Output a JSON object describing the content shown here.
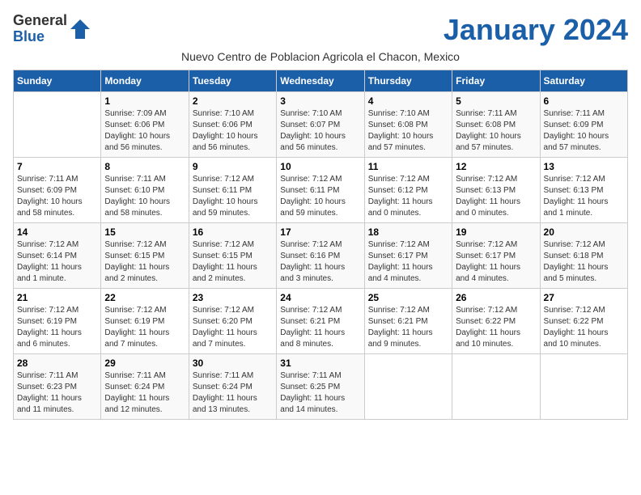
{
  "logo": {
    "general": "General",
    "blue": "Blue"
  },
  "header": {
    "month_title": "January 2024",
    "subtitle": "Nuevo Centro de Poblacion Agricola el Chacon, Mexico"
  },
  "days_of_week": [
    "Sunday",
    "Monday",
    "Tuesday",
    "Wednesday",
    "Thursday",
    "Friday",
    "Saturday"
  ],
  "weeks": [
    [
      {
        "day": "",
        "info": ""
      },
      {
        "day": "1",
        "info": "Sunrise: 7:09 AM\nSunset: 6:06 PM\nDaylight: 10 hours\nand 56 minutes."
      },
      {
        "day": "2",
        "info": "Sunrise: 7:10 AM\nSunset: 6:06 PM\nDaylight: 10 hours\nand 56 minutes."
      },
      {
        "day": "3",
        "info": "Sunrise: 7:10 AM\nSunset: 6:07 PM\nDaylight: 10 hours\nand 56 minutes."
      },
      {
        "day": "4",
        "info": "Sunrise: 7:10 AM\nSunset: 6:08 PM\nDaylight: 10 hours\nand 57 minutes."
      },
      {
        "day": "5",
        "info": "Sunrise: 7:11 AM\nSunset: 6:08 PM\nDaylight: 10 hours\nand 57 minutes."
      },
      {
        "day": "6",
        "info": "Sunrise: 7:11 AM\nSunset: 6:09 PM\nDaylight: 10 hours\nand 57 minutes."
      }
    ],
    [
      {
        "day": "7",
        "info": "Sunrise: 7:11 AM\nSunset: 6:09 PM\nDaylight: 10 hours\nand 58 minutes."
      },
      {
        "day": "8",
        "info": "Sunrise: 7:11 AM\nSunset: 6:10 PM\nDaylight: 10 hours\nand 58 minutes."
      },
      {
        "day": "9",
        "info": "Sunrise: 7:12 AM\nSunset: 6:11 PM\nDaylight: 10 hours\nand 59 minutes."
      },
      {
        "day": "10",
        "info": "Sunrise: 7:12 AM\nSunset: 6:11 PM\nDaylight: 10 hours\nand 59 minutes."
      },
      {
        "day": "11",
        "info": "Sunrise: 7:12 AM\nSunset: 6:12 PM\nDaylight: 11 hours\nand 0 minutes."
      },
      {
        "day": "12",
        "info": "Sunrise: 7:12 AM\nSunset: 6:13 PM\nDaylight: 11 hours\nand 0 minutes."
      },
      {
        "day": "13",
        "info": "Sunrise: 7:12 AM\nSunset: 6:13 PM\nDaylight: 11 hours\nand 1 minute."
      }
    ],
    [
      {
        "day": "14",
        "info": "Sunrise: 7:12 AM\nSunset: 6:14 PM\nDaylight: 11 hours\nand 1 minute."
      },
      {
        "day": "15",
        "info": "Sunrise: 7:12 AM\nSunset: 6:15 PM\nDaylight: 11 hours\nand 2 minutes."
      },
      {
        "day": "16",
        "info": "Sunrise: 7:12 AM\nSunset: 6:15 PM\nDaylight: 11 hours\nand 2 minutes."
      },
      {
        "day": "17",
        "info": "Sunrise: 7:12 AM\nSunset: 6:16 PM\nDaylight: 11 hours\nand 3 minutes."
      },
      {
        "day": "18",
        "info": "Sunrise: 7:12 AM\nSunset: 6:17 PM\nDaylight: 11 hours\nand 4 minutes."
      },
      {
        "day": "19",
        "info": "Sunrise: 7:12 AM\nSunset: 6:17 PM\nDaylight: 11 hours\nand 4 minutes."
      },
      {
        "day": "20",
        "info": "Sunrise: 7:12 AM\nSunset: 6:18 PM\nDaylight: 11 hours\nand 5 minutes."
      }
    ],
    [
      {
        "day": "21",
        "info": "Sunrise: 7:12 AM\nSunset: 6:19 PM\nDaylight: 11 hours\nand 6 minutes."
      },
      {
        "day": "22",
        "info": "Sunrise: 7:12 AM\nSunset: 6:19 PM\nDaylight: 11 hours\nand 7 minutes."
      },
      {
        "day": "23",
        "info": "Sunrise: 7:12 AM\nSunset: 6:20 PM\nDaylight: 11 hours\nand 7 minutes."
      },
      {
        "day": "24",
        "info": "Sunrise: 7:12 AM\nSunset: 6:21 PM\nDaylight: 11 hours\nand 8 minutes."
      },
      {
        "day": "25",
        "info": "Sunrise: 7:12 AM\nSunset: 6:21 PM\nDaylight: 11 hours\nand 9 minutes."
      },
      {
        "day": "26",
        "info": "Sunrise: 7:12 AM\nSunset: 6:22 PM\nDaylight: 11 hours\nand 10 minutes."
      },
      {
        "day": "27",
        "info": "Sunrise: 7:12 AM\nSunset: 6:22 PM\nDaylight: 11 hours\nand 10 minutes."
      }
    ],
    [
      {
        "day": "28",
        "info": "Sunrise: 7:11 AM\nSunset: 6:23 PM\nDaylight: 11 hours\nand 11 minutes."
      },
      {
        "day": "29",
        "info": "Sunrise: 7:11 AM\nSunset: 6:24 PM\nDaylight: 11 hours\nand 12 minutes."
      },
      {
        "day": "30",
        "info": "Sunrise: 7:11 AM\nSunset: 6:24 PM\nDaylight: 11 hours\nand 13 minutes."
      },
      {
        "day": "31",
        "info": "Sunrise: 7:11 AM\nSunset: 6:25 PM\nDaylight: 11 hours\nand 14 minutes."
      },
      {
        "day": "",
        "info": ""
      },
      {
        "day": "",
        "info": ""
      },
      {
        "day": "",
        "info": ""
      }
    ]
  ]
}
